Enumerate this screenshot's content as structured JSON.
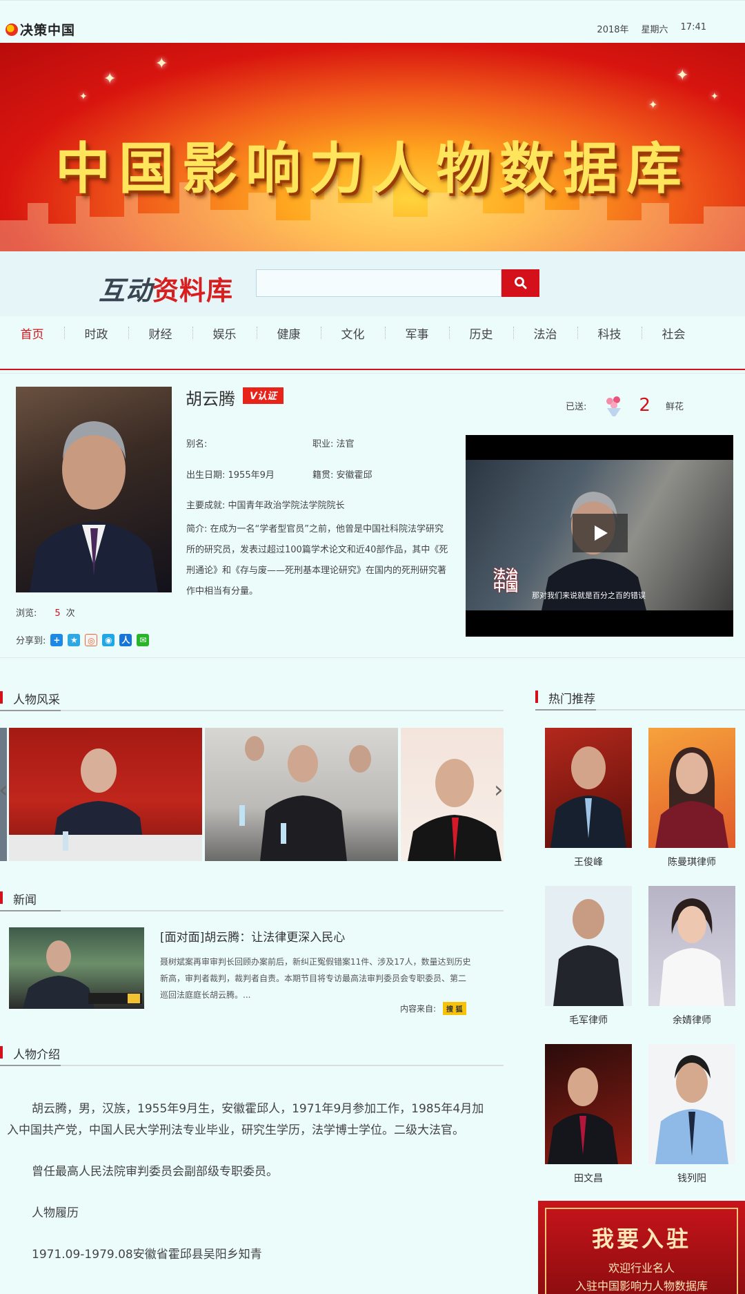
{
  "header": {
    "logo_text": "决策中国",
    "date_year": "2018年",
    "date_weekday": "星期六",
    "time": "17:41"
  },
  "banner": {
    "title": "中国影响力人物数据库"
  },
  "search": {
    "brand_part1": "互动",
    "brand_part2": "资料库",
    "placeholder": ""
  },
  "nav": {
    "items": [
      "首页",
      "时政",
      "财经",
      "娱乐",
      "健康",
      "文化",
      "军事",
      "历史",
      "法治",
      "科技",
      "社会"
    ],
    "active_index": 0
  },
  "profile": {
    "name": "胡云腾",
    "badge": "V认证",
    "alias": "别名:",
    "occupation": "职业: 法官",
    "birth": "出生日期: 1955年9月",
    "hometown": "籍贯: 安徽霍邱",
    "achievement": "主要成就: 中国青年政治学院法学院院长",
    "intro": "简介: 在成为一名“学者型官员”之前，他曾是中国社科院法学研究所的研究员，发表过超过100篇学术论文和近40部作品，其中《死刑通论》和《存与废——死刑基本理论研究》在国内的死刑研究著作中相当有分量。",
    "views_label": "浏览:",
    "views_count": "5",
    "views_unit": "次",
    "share_label": "分享到:",
    "sent_label": "已送:",
    "flowers_count": "2",
    "flowers_unit": "鲜花",
    "video_caption": "那对我们来说就是百分之百的错误",
    "video_logo_line1": "法治",
    "video_logo_line2": "中国"
  },
  "sections": {
    "gallery": "人物风采",
    "news": "新闻",
    "bio": "人物介绍",
    "hot": "热门推荐"
  },
  "news": {
    "title": "[面对面]胡云腾：让法律更深入民心",
    "summary": "聂树斌案再审审判长回顾办案前后，新纠正冤假错案11件、涉及17人，数量达到历史新高，审判者裁判，裁判者自责。本期节目将专访最高法审判委员会专职委员、第二巡回法庭庭长胡云腾。...",
    "source_label": "内容来自:",
    "source_logo": "搜 狐"
  },
  "bio": {
    "paragraphs": [
      "胡云腾，男，汉族，1955年9月生，安徽霍邱人，1971年9月参加工作，1985年4月加入中国共产党，中国人民大学刑法专业毕业，研究生学历，法学博士学位。二级大法官。",
      "曾任最高人民法院审判委员会副部级专职委员。",
      "人物履历",
      "1971.09-1979.08安徽省霍邱县吴阳乡知青"
    ]
  },
  "hot": {
    "people": [
      "王俊峰",
      "陈曼琪律师",
      "毛军律师",
      "余婧律师",
      "田文昌",
      "钱列阳"
    ]
  },
  "join": {
    "title": "我要入驻",
    "line1": "欢迎行业名人",
    "line2": "入驻中国影响力人物数据库"
  },
  "colors": {
    "accent": "#d4111b",
    "page_bg": "#ecfcfb"
  }
}
